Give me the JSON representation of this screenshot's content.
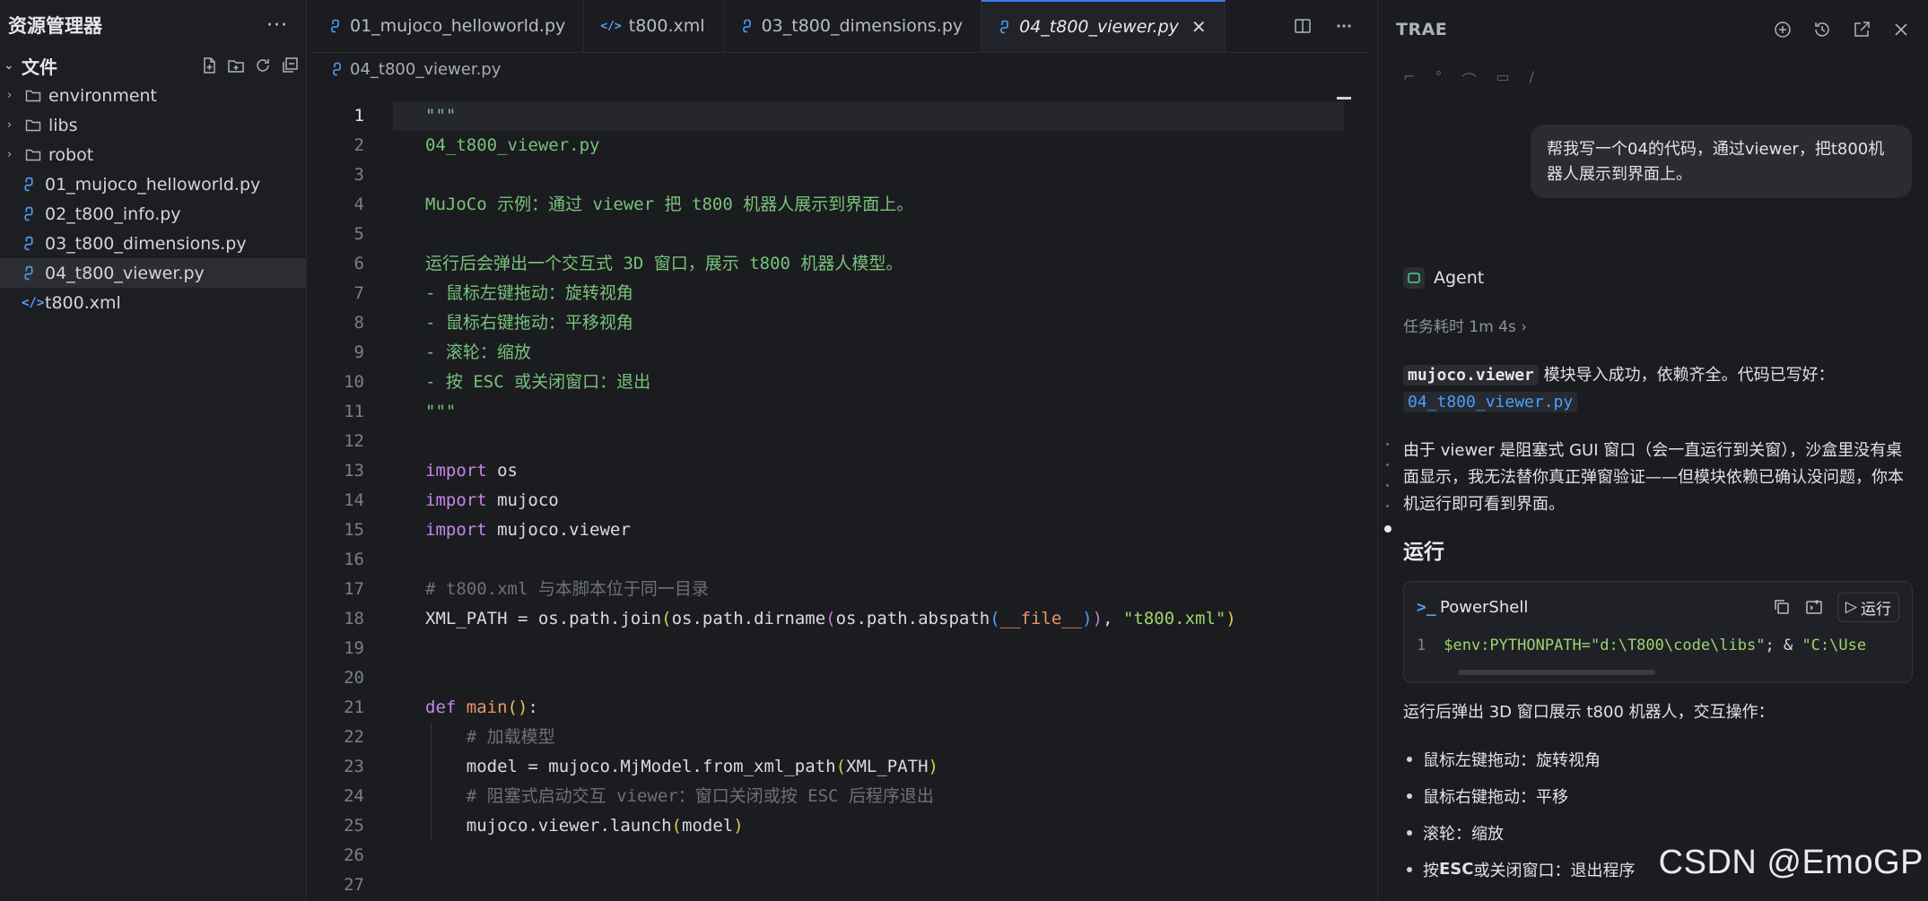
{
  "sidebar": {
    "title": "资源管理器",
    "more": "···",
    "section_title": "文件",
    "items": [
      {
        "label": "environment",
        "type": "folder"
      },
      {
        "label": "libs",
        "type": "folder"
      },
      {
        "label": "robot",
        "type": "folder"
      },
      {
        "label": "01_mujoco_helloworld.py",
        "type": "python"
      },
      {
        "label": "02_t800_info.py",
        "type": "python"
      },
      {
        "label": "03_t800_dimensions.py",
        "type": "python"
      },
      {
        "label": "04_t800_viewer.py",
        "type": "python",
        "active": true
      },
      {
        "label": "t800.xml",
        "type": "xml"
      }
    ]
  },
  "tabs": [
    {
      "label": "01_mujoco_helloworld.py",
      "icon": "python-icon"
    },
    {
      "label": "t800.xml",
      "icon": "xml-icon"
    },
    {
      "label": "03_t800_dimensions.py",
      "icon": "python-icon"
    },
    {
      "label": "04_t800_viewer.py",
      "icon": "python-icon",
      "active": true
    }
  ],
  "breadcrumb": "04_t800_viewer.py",
  "code_lines": [
    [
      [
        "doc",
        "\"\"\""
      ]
    ],
    [
      [
        "doc",
        "04_t800_viewer.py"
      ]
    ],
    [],
    [
      [
        "doc",
        "MuJoCo 示例：通过 viewer 把 t800 机器人展示到界面上。"
      ]
    ],
    [],
    [
      [
        "doc",
        "运行后会弹出一个交互式 3D 窗口，展示 t800 机器人模型。"
      ]
    ],
    [
      [
        "doc",
        "- 鼠标左键拖动：旋转视角"
      ]
    ],
    [
      [
        "doc",
        "- 鼠标右键拖动：平移视角"
      ]
    ],
    [
      [
        "doc",
        "- 滚轮：缩放"
      ]
    ],
    [
      [
        "doc",
        "- 按 ESC 或关闭窗口：退出"
      ]
    ],
    [
      [
        "doc",
        "\"\"\""
      ]
    ],
    [],
    [
      [
        "kw",
        "import"
      ],
      [
        "var",
        " os"
      ]
    ],
    [
      [
        "kw",
        "import"
      ],
      [
        "var",
        " mujoco"
      ]
    ],
    [
      [
        "kw",
        "import"
      ],
      [
        "var",
        " mujoco.viewer"
      ]
    ],
    [],
    [
      [
        "cm",
        "# t800.xml 与本脚本位于同一目录"
      ]
    ],
    [
      [
        "var",
        "XML_PATH = os.path.join"
      ],
      [
        "p1",
        "("
      ],
      [
        "var",
        "os.path.dirname"
      ],
      [
        "p2",
        "("
      ],
      [
        "var",
        "os.path.abspath"
      ],
      [
        "p3",
        "("
      ],
      [
        "mg",
        "__file__"
      ],
      [
        "p3",
        ")"
      ],
      [
        "p2",
        ")"
      ],
      [
        "var",
        ", "
      ],
      [
        "str",
        "\"t800.xml\""
      ],
      [
        "p1",
        ")"
      ]
    ],
    [],
    [],
    [
      [
        "kw",
        "def"
      ],
      [
        "fn",
        " main"
      ],
      [
        "p1",
        "()"
      ],
      [
        "var",
        ":"
      ]
    ],
    [
      [
        "var",
        "    "
      ],
      [
        "cm",
        "# 加载模型"
      ]
    ],
    [
      [
        "var",
        "    model = mujoco.MjModel.from_xml_path"
      ],
      [
        "p1",
        "("
      ],
      [
        "var",
        "XML_PATH"
      ],
      [
        "p1",
        ")"
      ]
    ],
    [
      [
        "var",
        "    "
      ],
      [
        "cm",
        "# 阻塞式启动交互 viewer：窗口关闭或按 ESC 后程序退出"
      ]
    ],
    [
      [
        "var",
        "    mujoco.viewer.launch"
      ],
      [
        "p1",
        "("
      ],
      [
        "var",
        "model"
      ],
      [
        "p1",
        ")"
      ]
    ],
    [],
    []
  ],
  "panel": {
    "title": "TRAE",
    "user_message": "帮我写一个04的代码，通过viewer，把t800机器人展示到界面上。",
    "agent_name": "Agent",
    "elapsed": "任务耗时 1m 4s",
    "msg1_code": "mujoco.viewer",
    "msg1_text": " 模块导入成功，依赖齐全。代码已写好：",
    "msg1_link": "04_t800_viewer.py",
    "msg2": "由于 viewer 是阻塞式 GUI 窗口（会一直运行到关窗），沙盒里没有桌面显示，我无法替你真正弹窗验证——但模块依赖已确认没问题，你本机运行即可看到界面。",
    "run_heading": "运行",
    "shell_name": "PowerShell",
    "run_label": "运行",
    "shell_line_no": "1",
    "shell_cmd_part1": "$env:PYTHONPATH=\"d:\\T800\\code\\libs\"",
    "shell_cmd_part2": "; & ",
    "shell_cmd_part3": "\"C:\\Use",
    "after_run": "运行后弹出 3D 窗口展示 t800 机器人，交互操作：",
    "bullets": [
      {
        "label": "鼠标左键拖动：旋转视角"
      },
      {
        "label": "鼠标右键拖动：平移"
      },
      {
        "label": "滚轮：缩放"
      },
      {
        "prefix": "按 ",
        "bold": "ESC",
        "suffix": " 或关闭窗口：退出程序"
      }
    ]
  },
  "watermark": "CSDN @EmoGP",
  "colors": {
    "accent": "#3c7cf0",
    "keyword": "#c586e8",
    "string": "#9ed46e",
    "docstring": "#78c27c",
    "function": "#e8956a",
    "comment": "#6d7178",
    "link": "#4d9ef6"
  }
}
